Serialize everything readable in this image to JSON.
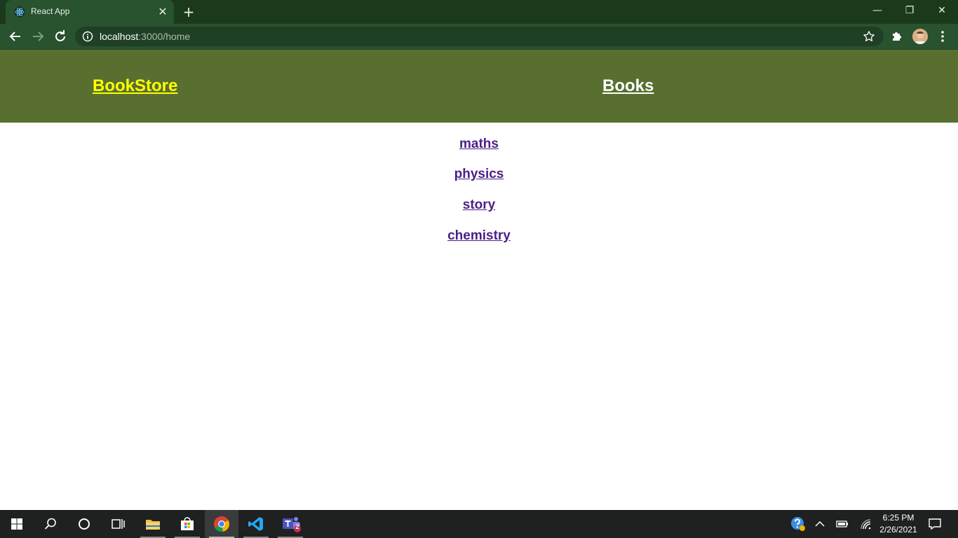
{
  "browser": {
    "tab_title": "React App",
    "close_glyph": "✕",
    "newtab_glyph": "+",
    "window_controls": {
      "minimize": "—",
      "maximize": "❐",
      "close": "✕"
    },
    "url_host": "localhost",
    "url_path": ":3000/home"
  },
  "app": {
    "brand": "BookStore",
    "nav_books": "Books",
    "categories": [
      "maths",
      "physics",
      "story",
      "chemistry"
    ],
    "colors": {
      "header_bg": "#586f30",
      "brand": "#ffff00",
      "nav": "#ffffff",
      "link": "#4b1f87"
    }
  },
  "taskbar": {
    "time": "6:25 PM",
    "date": "2/26/2021",
    "teams_badge": "2"
  }
}
